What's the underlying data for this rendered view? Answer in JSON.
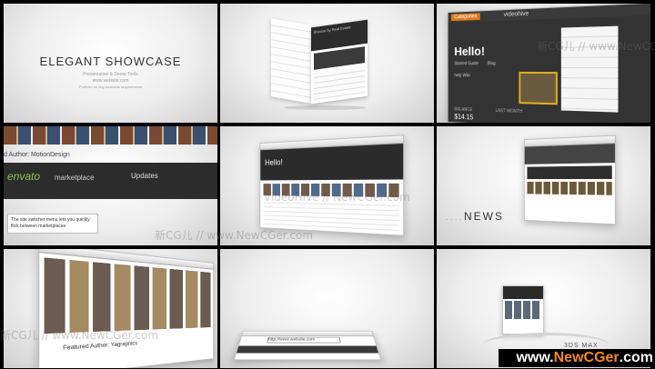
{
  "panel1": {
    "title": "ELEGANT SHOWCASE",
    "subtitle": "Presentation & Demo Tools",
    "website": "www.website.com",
    "small_line": "Portfolio for any business requirements"
  },
  "panel2": {
    "cube_header": "Browse by Real Estate"
  },
  "panel3": {
    "tab": "Categories",
    "site": "videohive",
    "hello": "Hello!",
    "body_lines": [
      "Started Guide",
      "Blog",
      "help Wiki"
    ],
    "balance_label": "BALANCE",
    "balance_value": "$14.15",
    "last_month": "LAST MONTH"
  },
  "panel4": {
    "author_line": "d Author: MotionDesign",
    "envato": "envato",
    "marketplace": "marketplace",
    "updates": "Updates",
    "tooltip": "The site switcher menu lets you quickly flick between marketplaces"
  },
  "panel5": {
    "hello": "Hello!"
  },
  "panel6": {
    "word": "NEWS"
  },
  "panel7": {
    "featured": "Featured Author: Yagraphics"
  },
  "panel8": {
    "url": "http://www.website.com"
  },
  "panel9": {
    "software": "3DS MAX"
  },
  "watermarks": {
    "text1": "新CG儿 // www.NewCGer.com // 新CG儿",
    "text2": "VideoHive // NewCGer.com",
    "text3": "新CG儿 // www.NewCGer.com"
  },
  "brand": {
    "prefix": "www.",
    "highlight": "NewCGer",
    "suffix": ".com"
  }
}
